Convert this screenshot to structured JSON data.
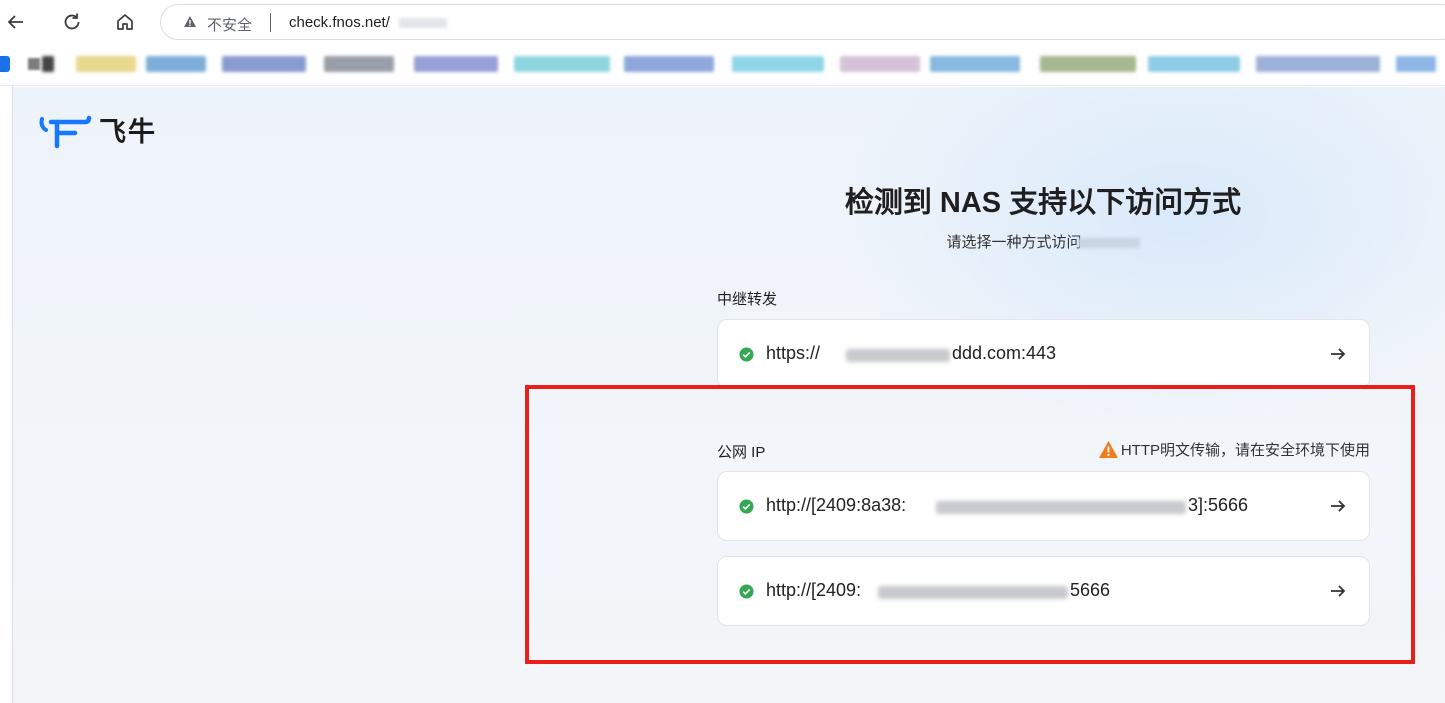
{
  "browser": {
    "security_status": "不安全",
    "url": "check.fnos.net/"
  },
  "page": {
    "logo_text": "飞牛",
    "title": "检测到 NAS 支持以下访问方式",
    "subtitle": "请选择一种方式访问",
    "relay": {
      "label": "中继转发",
      "entries": [
        {
          "url": "https://",
          "url_tail": "ddd.com:443"
        }
      ]
    },
    "public_ip": {
      "label": "公网 IP",
      "warning": "HTTP明文传输，请在安全环境下使用",
      "entries": [
        {
          "url": "http://[2409:8a38:",
          "url_tail": "3]:5666"
        },
        {
          "url": "http://[2409:",
          "url_tail": "5666"
        }
      ]
    }
  },
  "colors": {
    "accent": "#1a73e8",
    "status_ok": "#34a853",
    "warning": "#f07c1e",
    "highlight_box": "#e8201c"
  }
}
